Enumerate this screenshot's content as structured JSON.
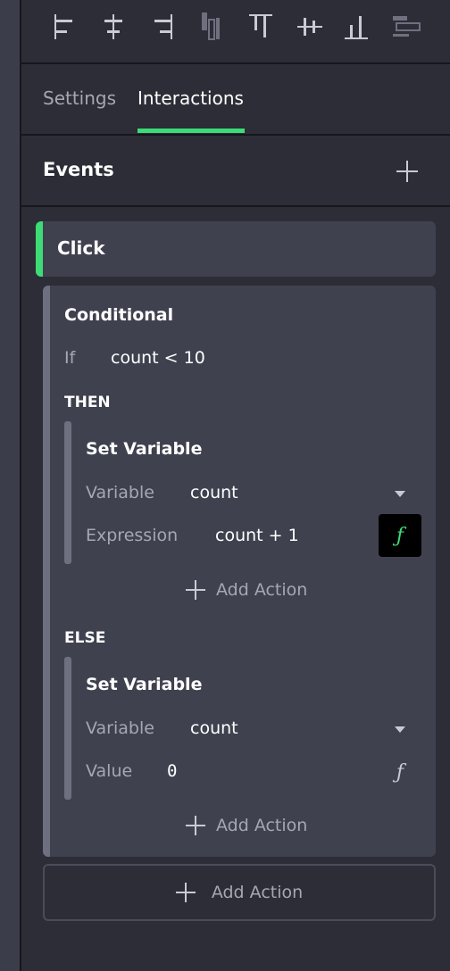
{
  "toolbar": {
    "icons": [
      "align-left-icon",
      "align-horizontal-center-icon",
      "align-right-icon",
      "distribute-horizontal-icon",
      "align-top-icon",
      "align-vertical-center-icon",
      "align-bottom-icon",
      "distribute-vertical-icon"
    ]
  },
  "tabs": {
    "settings": "Settings",
    "interactions": "Interactions",
    "active": "Interactions"
  },
  "events": {
    "title": "Events",
    "add_icon": "plus-icon"
  },
  "event": {
    "label": "Click"
  },
  "conditional": {
    "title": "Conditional",
    "if_label": "If",
    "condition": "count < 10",
    "then_label": "THEN",
    "else_label": "ELSE",
    "then_action": {
      "title": "Set Variable",
      "variable_label": "Variable",
      "variable_value": "count",
      "expression_label": "Expression",
      "expression_value": "count + 1",
      "fx_symbol": "ƒ",
      "fx_active": true
    },
    "else_action": {
      "title": "Set Variable",
      "variable_label": "Variable",
      "variable_value": "count",
      "value_label": "Value",
      "value_value": "0",
      "fx_symbol": "ƒ",
      "fx_active": false
    },
    "add_action_label": "Add Action"
  },
  "add_action_label": "Add Action",
  "colors": {
    "accent": "#3ddc77",
    "panel_bg": "#2c2d36",
    "card_bg": "#3f414f",
    "muted_text": "#a5a7b3"
  }
}
